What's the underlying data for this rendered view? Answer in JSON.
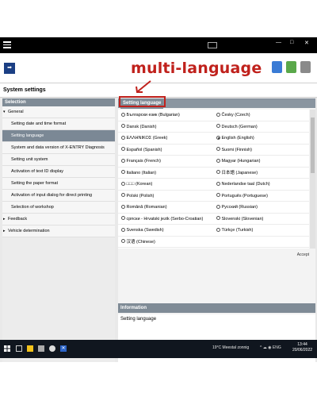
{
  "annotation": "multi-language",
  "toolbar": {
    "title": "System settings"
  },
  "left_panel": {
    "header": "Selection",
    "items": [
      {
        "label": "General",
        "level": "top",
        "arrow": "▾"
      },
      {
        "label": "Setting date and time format",
        "level": "sub"
      },
      {
        "label": "Setting language",
        "level": "sub",
        "selected": true
      },
      {
        "label": "System and data version of X-ENTRY Diagnosis",
        "level": "sub"
      },
      {
        "label": "Setting unit system",
        "level": "sub"
      },
      {
        "label": "Activation of text ID display",
        "level": "sub"
      },
      {
        "label": "Setting the paper format",
        "level": "sub"
      },
      {
        "label": "Activation of input dialog for direct printing",
        "level": "sub"
      },
      {
        "label": "Selection of workshop",
        "level": "sub"
      },
      {
        "label": "Feedback",
        "level": "top",
        "arrow": "▸"
      },
      {
        "label": "Vehicle determination",
        "level": "top",
        "arrow": "▸"
      }
    ]
  },
  "right_panel": {
    "header": "Setting language",
    "languages": [
      [
        "Български език (Bulgarian)",
        "Česky (Czech)"
      ],
      [
        "Dansk (Danish)",
        "Deutsch (German)"
      ],
      [
        "ΕΛΛΗΝΙΚΟΣ (Greek)",
        "English (English)"
      ],
      [
        "Español (Spanish)",
        "Suomi (Finnish)"
      ],
      [
        "Français (French)",
        "Magyar (Hungarian)"
      ],
      [
        "Italiano (Italian)",
        "日本語 (Japanese)"
      ],
      [
        "□□□ (Korean)",
        "Nederlandse taal (Dutch)"
      ],
      [
        "Polski (Polish)",
        "Português (Portuguese)"
      ],
      [
        "Română (Romanian)",
        "Русский (Russian)"
      ],
      [
        "српски - Hrvatski jezik (Serbo-Croatian)",
        "Slovenski (Slovenian)"
      ],
      [
        "Svenska (Swedish)",
        "Türkçe (Turkish)"
      ],
      [
        "汉语 (Chinese)",
        ""
      ]
    ],
    "selected_language": "English (English)",
    "accept_label": "Accept",
    "info_header": "Information",
    "info_text": "Setting language"
  },
  "taskbar": {
    "weather": "19°C  Meestal zonnig",
    "tray": "^ ☁ ◉ ENG",
    "time": "13:44",
    "date": "20/06/2022"
  },
  "colors": {
    "accent": "#7b8895",
    "annotation": "#c0211c",
    "titlebar": "#000000",
    "taskbar": "#10161f"
  }
}
